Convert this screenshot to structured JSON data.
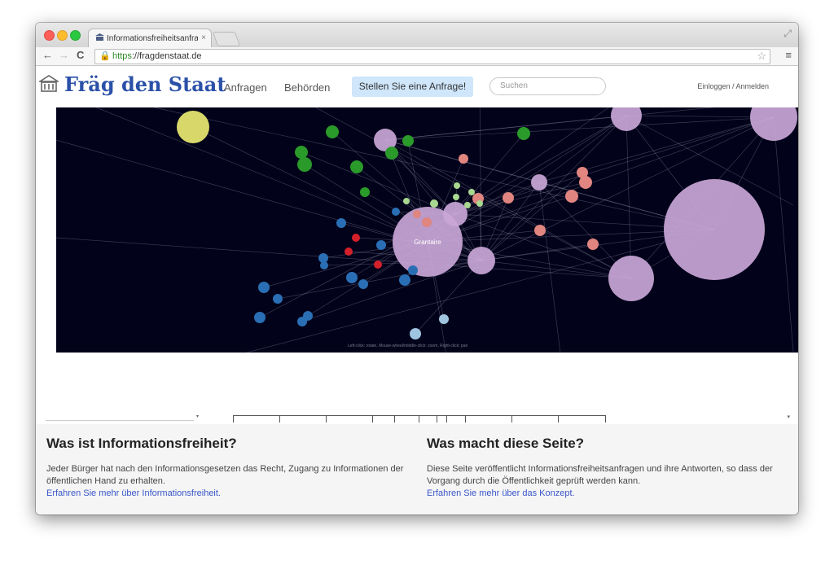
{
  "browser": {
    "tab_title": "Informationsfreiheitsanfrage",
    "tab_close": "×",
    "url_scheme": "https",
    "url_rest": "://fragdenstaat.de",
    "back": "←",
    "forward": "→",
    "reload": "C",
    "star": "☆",
    "menu": "≡",
    "resize": "⤢"
  },
  "site": {
    "logo_icon": "building-icon",
    "logo_text": "Fräg den Staat",
    "nav": [
      "Anfragen",
      "Behörden"
    ],
    "cta": "Stellen Sie eine Anfrage!",
    "search_placeholder": "Suchen",
    "login": "Einloggen / Anmelden"
  },
  "graph": {
    "background": "#02021a",
    "center_label": "Grantaire",
    "hint": "Left-click: rotate, Mouse-wheel/middle-click: zoom, Right-click: pan",
    "colors": {
      "purple": "#c9a6d6",
      "green": "#2a9a2a",
      "pink": "#e0857f",
      "blue": "#2a6fb5",
      "red": "#d4202a",
      "yellow": "#d8d86a",
      "lightblue": "#9fc4e0",
      "lightgreen": "#a8d890"
    }
  },
  "info": {
    "left": {
      "title": "Was ist Informationsfreiheit?",
      "text": "Jeder Bürger hat nach den Informationsgesetzen das Recht, Zugang zu Informationen der öffentlichen Hand zu erhalten.",
      "link": "Erfahren Sie mehr über Informationsfreiheit."
    },
    "right": {
      "title": "Was macht diese Seite?",
      "text": "Diese Seite veröffentlicht Informationsfreiheitsanfragen und ihre Antworten, so dass der Vorgang durch die Öffentlichkeit geprüft werden kann.",
      "link": "Erfahren Sie mehr über das Konzept."
    }
  }
}
